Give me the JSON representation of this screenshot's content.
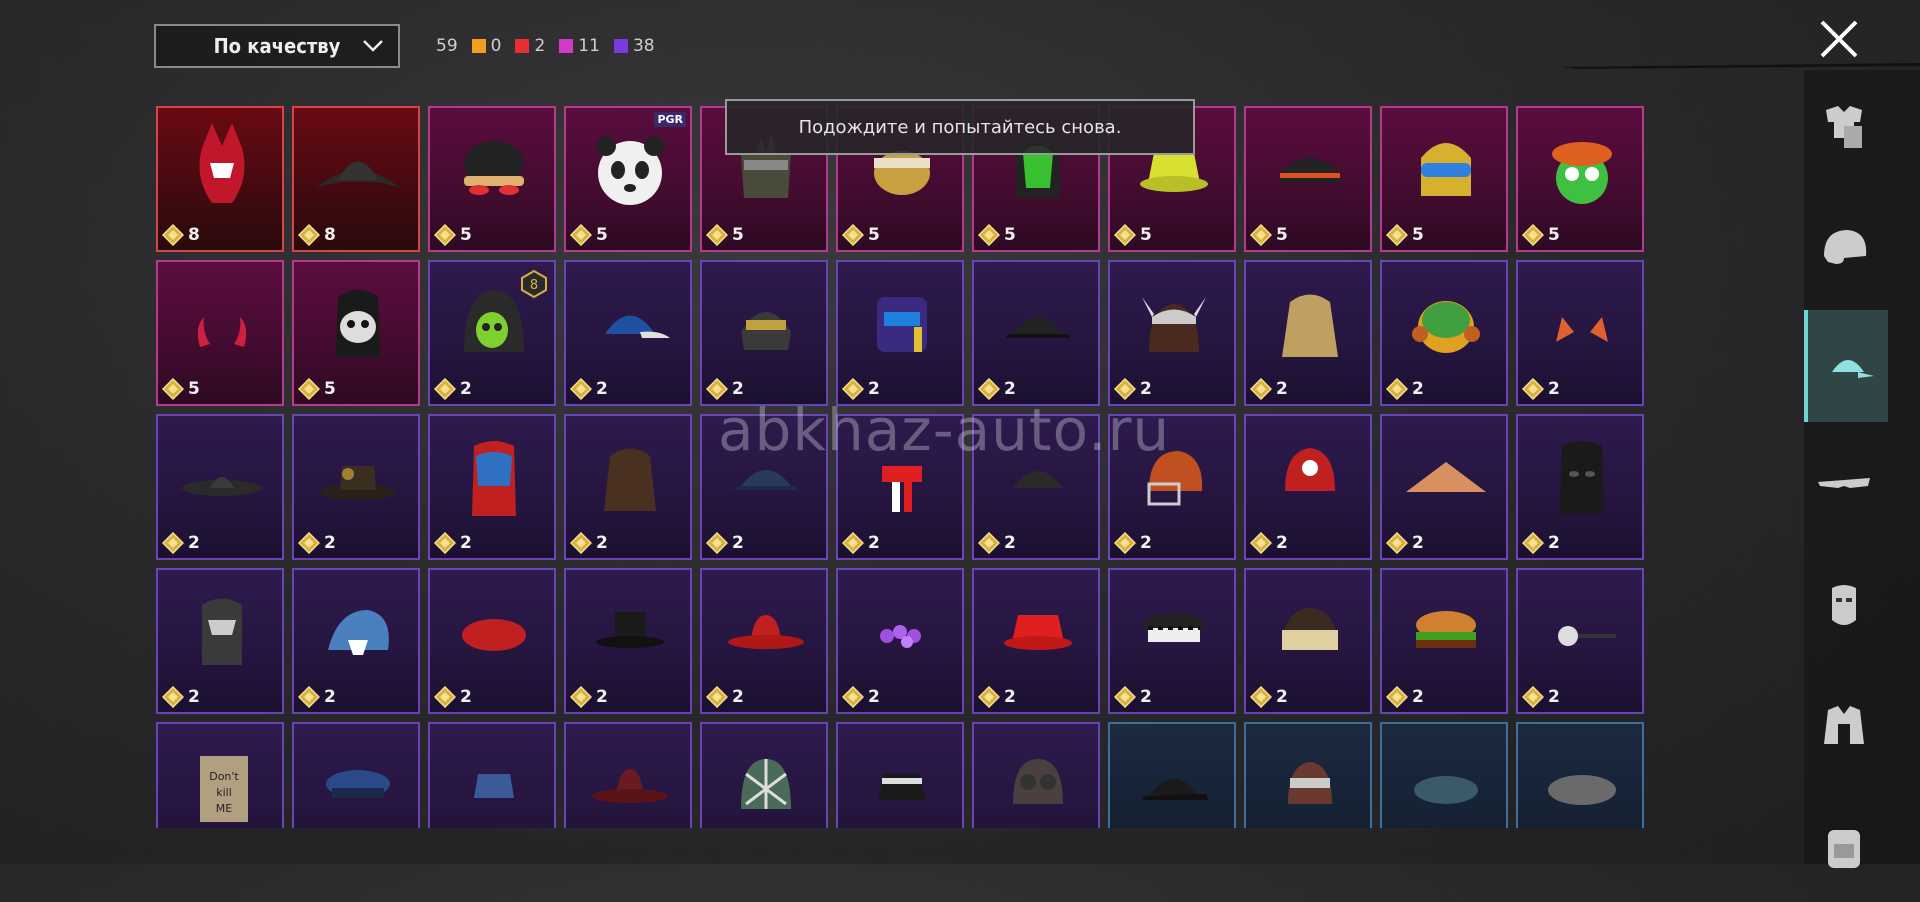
{
  "sort": {
    "label": "По качеству",
    "icon": "chevron-down-icon"
  },
  "counts": {
    "total": "59",
    "orange": "0",
    "red": "2",
    "pink": "11",
    "purple": "38",
    "colors": {
      "orange": "#f0a020",
      "red": "#e83030",
      "pink": "#d43ac8",
      "purple": "#7b3ae0"
    }
  },
  "toast": {
    "message": "Подождите и попытайтесь снова."
  },
  "watermark": "abkhaz-auto.ru",
  "close_icon": "close-icon",
  "sidebar": {
    "items": [
      {
        "icon": "outfit-icon"
      },
      {
        "icon": "helmet-icon"
      },
      {
        "icon": "cap-icon",
        "active": true
      },
      {
        "icon": "glasses-icon"
      },
      {
        "icon": "mask-icon"
      },
      {
        "icon": "jacket-icon"
      },
      {
        "icon": "backpack-icon"
      }
    ]
  },
  "grid": {
    "items": [
      {
        "rarity": "red",
        "price": "8",
        "icon": "samurai-helmet-icon"
      },
      {
        "rarity": "red",
        "price": "8",
        "icon": "tricorn-hat-icon"
      },
      {
        "rarity": "pink",
        "price": "5",
        "icon": "cap-goggles-icon"
      },
      {
        "rarity": "pink",
        "price": "5",
        "icon": "panda-head-icon",
        "badge": "PGR"
      },
      {
        "rarity": "pink",
        "price": "5",
        "icon": "spiked-mask-icon"
      },
      {
        "rarity": "pink",
        "price": "5",
        "icon": "headband-icon"
      },
      {
        "rarity": "pink",
        "price": "5",
        "icon": "green-helmet-icon"
      },
      {
        "rarity": "pink",
        "price": "5",
        "icon": "yellow-bucket-hat-icon"
      },
      {
        "rarity": "pink",
        "price": "5",
        "icon": "bandana-icon"
      },
      {
        "rarity": "pink",
        "price": "5",
        "icon": "ski-helmet-icon"
      },
      {
        "rarity": "pink",
        "price": "5",
        "icon": "frog-hat-icon"
      },
      {
        "rarity": "pink",
        "price": "5",
        "icon": "devil-horns-icon"
      },
      {
        "rarity": "pink",
        "price": "5",
        "icon": "skull-mask-icon"
      },
      {
        "rarity": "purple",
        "price": "2",
        "icon": "green-skull-hood-icon",
        "level": "8"
      },
      {
        "rarity": "purple",
        "price": "2",
        "icon": "baseball-cap-icon"
      },
      {
        "rarity": "purple",
        "price": "2",
        "icon": "tactical-helmet-icon"
      },
      {
        "rarity": "purple",
        "price": "2",
        "icon": "robot-helmet-icon"
      },
      {
        "rarity": "purple",
        "price": "2",
        "icon": "black-cap-icon"
      },
      {
        "rarity": "purple",
        "price": "2",
        "icon": "viking-hat-icon"
      },
      {
        "rarity": "purple",
        "price": "2",
        "icon": "blonde-hair-icon"
      },
      {
        "rarity": "purple",
        "price": "2",
        "icon": "headphones-hat-icon"
      },
      {
        "rarity": "purple",
        "price": "2",
        "icon": "fox-ears-icon"
      },
      {
        "rarity": "purple",
        "price": "2",
        "icon": "sombrero-icon"
      },
      {
        "rarity": "purple",
        "price": "2",
        "icon": "steampunk-hat-icon"
      },
      {
        "rarity": "purple",
        "price": "2",
        "icon": "orange-mask-icon"
      },
      {
        "rarity": "purple",
        "price": "2",
        "icon": "brown-hair-icon"
      },
      {
        "rarity": "purple",
        "price": "2",
        "icon": "navy-cap-icon"
      },
      {
        "rarity": "purple",
        "price": "2",
        "icon": "red-headband-icon"
      },
      {
        "rarity": "purple",
        "price": "2",
        "icon": "dark-cap-icon"
      },
      {
        "rarity": "purple",
        "price": "2",
        "icon": "football-helmet-icon"
      },
      {
        "rarity": "purple",
        "price": "2",
        "icon": "skull-bandana-icon"
      },
      {
        "rarity": "purple",
        "price": "2",
        "icon": "conical-hat-icon"
      },
      {
        "rarity": "purple",
        "price": "2",
        "icon": "balaclava-icon"
      },
      {
        "rarity": "purple",
        "price": "2",
        "icon": "luchador-mask-icon"
      },
      {
        "rarity": "purple",
        "price": "2",
        "icon": "shark-hat-icon"
      },
      {
        "rarity": "purple",
        "price": "2",
        "icon": "red-beret-icon"
      },
      {
        "rarity": "purple",
        "price": "2",
        "icon": "top-hat-icon"
      },
      {
        "rarity": "purple",
        "price": "2",
        "icon": "red-fedora-icon"
      },
      {
        "rarity": "purple",
        "price": "2",
        "icon": "flower-crown-icon"
      },
      {
        "rarity": "purple",
        "price": "2",
        "icon": "red-bucket-hat-icon"
      },
      {
        "rarity": "purple",
        "price": "2",
        "icon": "police-cap-icon"
      },
      {
        "rarity": "purple",
        "price": "2",
        "icon": "cake-hat-icon"
      },
      {
        "rarity": "purple",
        "price": "2",
        "icon": "burger-hat-icon"
      },
      {
        "rarity": "purple",
        "price": "2",
        "icon": "head-mirror-icon"
      },
      {
        "rarity": "purple",
        "price": "",
        "icon": "box-hat-icon",
        "text": "Don't kill ME"
      },
      {
        "rarity": "purple",
        "price": "",
        "icon": "pilot-cap-icon"
      },
      {
        "rarity": "purple",
        "price": "",
        "icon": "blue-fez-icon"
      },
      {
        "rarity": "purple",
        "price": "",
        "icon": "brown-fedora-icon"
      },
      {
        "rarity": "purple",
        "price": "",
        "icon": "net-helmet-icon"
      },
      {
        "rarity": "purple",
        "price": "",
        "icon": "black-bucket-hat-icon"
      },
      {
        "rarity": "purple",
        "price": "",
        "icon": "aviator-hat-icon"
      },
      {
        "rarity": "blue",
        "price": "",
        "icon": "black-baseball-cap-icon"
      },
      {
        "rarity": "blue",
        "price": "",
        "icon": "bandage-head-icon"
      },
      {
        "rarity": "blue",
        "price": "",
        "icon": "blue-beret-icon"
      },
      {
        "rarity": "blue",
        "price": "",
        "icon": "grey-beret-icon"
      }
    ]
  }
}
